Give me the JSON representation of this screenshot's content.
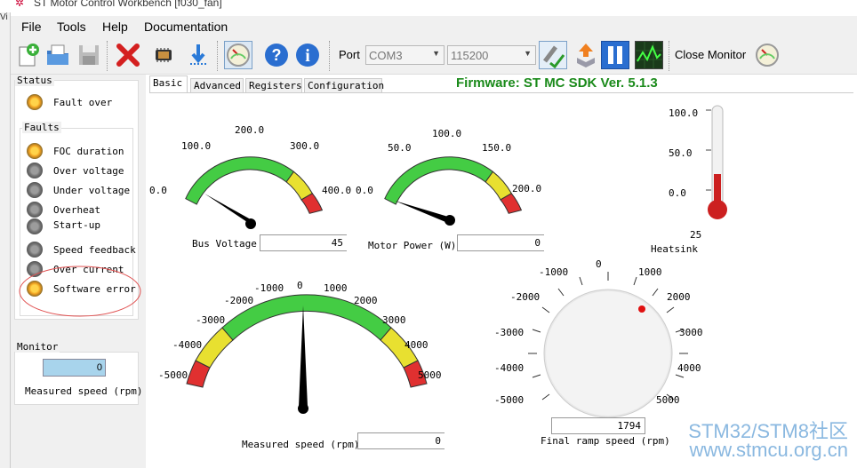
{
  "window": {
    "title": "ST Motor Control Workbench [f030_fan]",
    "left_edge": "Vi"
  },
  "menu": [
    "File",
    "Tools",
    "Help",
    "Documentation"
  ],
  "toolbar": {
    "port_label": "Port",
    "port_value": "COM3",
    "baud_value": "115200",
    "close_monitor_label": "Close Monitor"
  },
  "status": {
    "title": "Status",
    "fault_over": "Fault over",
    "faults_title": "Faults",
    "faults": [
      {
        "label": "FOC duration",
        "state": "on"
      },
      {
        "label": "Over voltage",
        "state": "off"
      },
      {
        "label": "Under voltage",
        "state": "off"
      },
      {
        "label": "Overheat",
        "state": "off"
      },
      {
        "label": "Start-up",
        "state": "off"
      },
      {
        "label": "Speed feedback",
        "state": "off"
      },
      {
        "label": "Over current",
        "state": "off"
      },
      {
        "label": "Software error",
        "state": "on"
      }
    ]
  },
  "monitor": {
    "title": "Monitor",
    "value": "0",
    "label": "Measured speed (rpm)"
  },
  "tabs": [
    "Basic",
    "Advanced",
    "Registers",
    "Configuration"
  ],
  "firmware": "Firmware: ST MC SDK Ver. 5.1.3",
  "bus_voltage": {
    "ticks": [
      "0.0",
      "100.0",
      "200.0",
      "300.0",
      "400.0"
    ],
    "label": "Bus Voltage",
    "value": "45"
  },
  "motor_power": {
    "ticks": [
      "0.0",
      "50.0",
      "100.0",
      "150.0",
      "200.0"
    ],
    "label": "Motor Power (W)",
    "value": "0"
  },
  "heatsink": {
    "ticks": [
      "100.0",
      "50.0",
      "0.0"
    ],
    "value": "25",
    "label": "Heatsink"
  },
  "measured_speed": {
    "ticks": [
      "-5000",
      "-4000",
      "-3000",
      "-2000",
      "-1000",
      "0",
      "1000",
      "2000",
      "3000",
      "4000",
      "5000"
    ],
    "label": "Measured speed (rpm)",
    "value": "0"
  },
  "final_ramp": {
    "ticks": [
      "-5000",
      "-4000",
      "-3000",
      "-2000",
      "-1000",
      "0",
      "1000",
      "2000",
      "3000",
      "4000",
      "5000"
    ],
    "label": "Final ramp speed (rpm)",
    "value": "1794"
  },
  "watermark": {
    "line1": "STM32/STM8社区",
    "line2": "www.stmcu.org.cn"
  },
  "colors": {
    "accent_green": "#1a8a1a",
    "gauge_green": "#44cc44",
    "gauge_yellow": "#e8e030",
    "gauge_red": "#e03030",
    "thermometer": "#cc2020"
  }
}
